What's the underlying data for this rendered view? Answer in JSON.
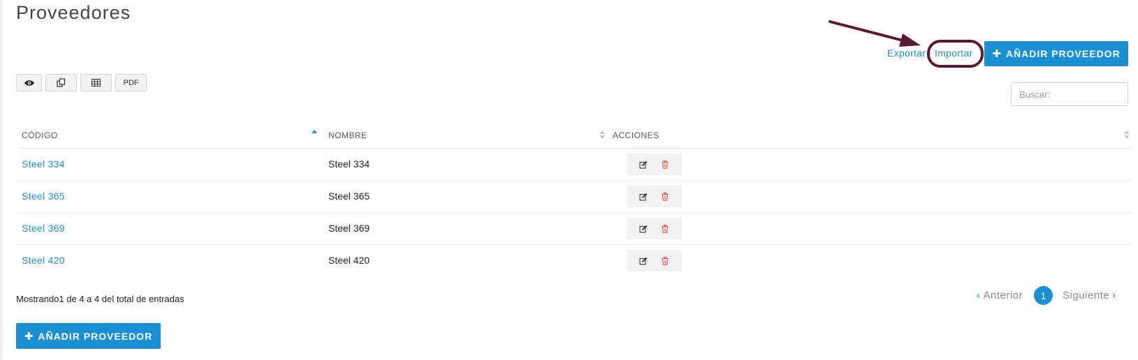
{
  "page": {
    "title": "Proveedores"
  },
  "header_actions": {
    "export_label": "Exportar",
    "import_label": "Importar",
    "add_label": "AÑADIR PROVEEDOR"
  },
  "toolbar": {
    "buttons": [
      {
        "name": "view-toggle-button",
        "icon": "eye-icon"
      },
      {
        "name": "copy-button",
        "icon": "copy-icon"
      },
      {
        "name": "excel-button",
        "icon": "table-icon"
      },
      {
        "name": "pdf-button",
        "label": "PDF"
      }
    ]
  },
  "search": {
    "placeholder": "Buscar:",
    "value": ""
  },
  "table": {
    "columns": [
      "CÓDIGO",
      "NOMBRE",
      "ACCIONES"
    ],
    "rows": [
      {
        "code": "Steel 334",
        "name": "Steel 334"
      },
      {
        "code": "Steel 365",
        "name": "Steel 365"
      },
      {
        "code": "Steel 369",
        "name": "Steel 369"
      },
      {
        "code": "Steel 420",
        "name": "Steel 420"
      }
    ]
  },
  "summary": "Mostrando1 de 4 a 4 del total de entradas",
  "pagination": {
    "prev_label": "Anterior",
    "current_page": "1",
    "next_label": "Siguiente"
  },
  "footer_actions": {
    "add_label": "AÑADIR PROVEEDOR"
  },
  "colors": {
    "accent": "#1a8fd4",
    "danger": "#e0484a",
    "annotation": "#5a1a34"
  }
}
